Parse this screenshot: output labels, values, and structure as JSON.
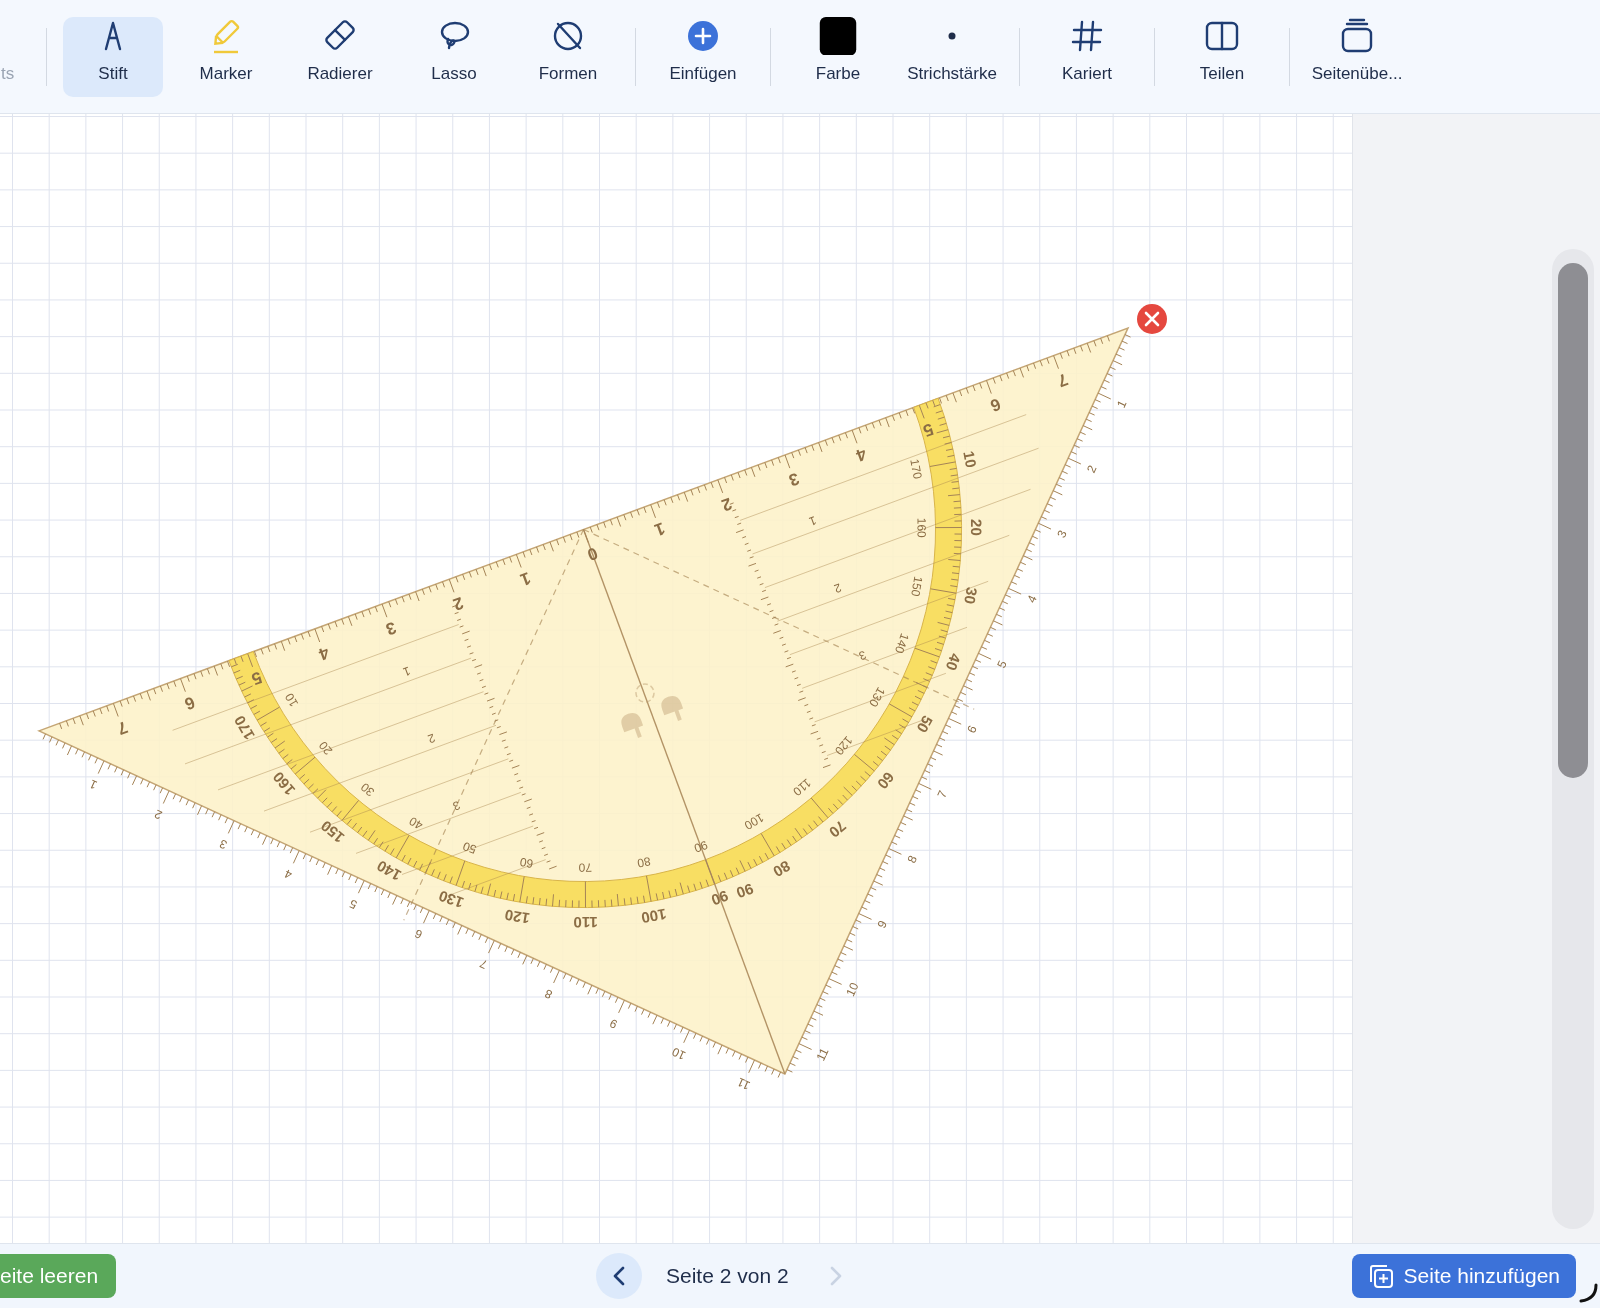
{
  "toolbar": {
    "groups": [
      [
        {
          "label": "ts",
          "selected": false,
          "disabled": true
        }
      ],
      [
        {
          "label": "Stift",
          "selected": true,
          "disabled": false
        },
        {
          "label": "Marker",
          "selected": false,
          "disabled": false
        },
        {
          "label": "Radierer",
          "selected": false,
          "disabled": false
        },
        {
          "label": "Lasso",
          "selected": false,
          "disabled": false
        },
        {
          "label": "Formen",
          "selected": false,
          "disabled": false
        }
      ],
      [
        {
          "label": "Einfügen",
          "selected": false,
          "disabled": false
        }
      ],
      [
        {
          "label": "Farbe",
          "selected": false,
          "disabled": false,
          "color": "#000000"
        },
        {
          "label": "Strichstärke",
          "selected": false,
          "disabled": false
        }
      ],
      [
        {
          "label": "Kariert",
          "selected": false,
          "disabled": false
        }
      ],
      [
        {
          "label": "Teilen",
          "selected": false,
          "disabled": false
        }
      ],
      [
        {
          "label": "Seitenübe...",
          "selected": false,
          "disabled": false
        }
      ]
    ]
  },
  "set_square": {
    "hypotenuse_labels": [
      "7",
      "6",
      "5",
      "4",
      "3",
      "2",
      "1",
      "0",
      "1",
      "2",
      "3",
      "4",
      "5",
      "6",
      "7"
    ],
    "outer_angle_labels": [
      "10",
      "20",
      "30",
      "40",
      "50",
      "60",
      "70",
      "80",
      "90",
      "100",
      "110",
      "120",
      "130",
      "140",
      "150",
      "160",
      "170"
    ],
    "inner_angle_labels": [
      "170",
      "160",
      "150",
      "140",
      "130",
      "120",
      "110",
      "100",
      "90",
      "80",
      "70",
      "60",
      "50",
      "40",
      "30",
      "20",
      "10"
    ],
    "center_line_label": "90",
    "left_leg_labels": [
      "1",
      "2",
      "3",
      "4",
      "5",
      "6",
      "7",
      "8",
      "9",
      "10",
      "11"
    ],
    "right_leg_labels": [
      "1",
      "2",
      "3",
      "4",
      "5",
      "6",
      "7",
      "8",
      "9",
      "10",
      "11"
    ],
    "left_guide_labels": [
      "1",
      "2",
      "3"
    ],
    "right_guide_labels": [
      "1",
      "2",
      "3"
    ]
  },
  "clear_button": {
    "label": "eite leeren"
  },
  "pager": {
    "label": "Seite 2 von 2",
    "prev_disabled": false,
    "next_disabled": true
  },
  "add_page_button": {
    "label": "Seite hinzufügen"
  }
}
